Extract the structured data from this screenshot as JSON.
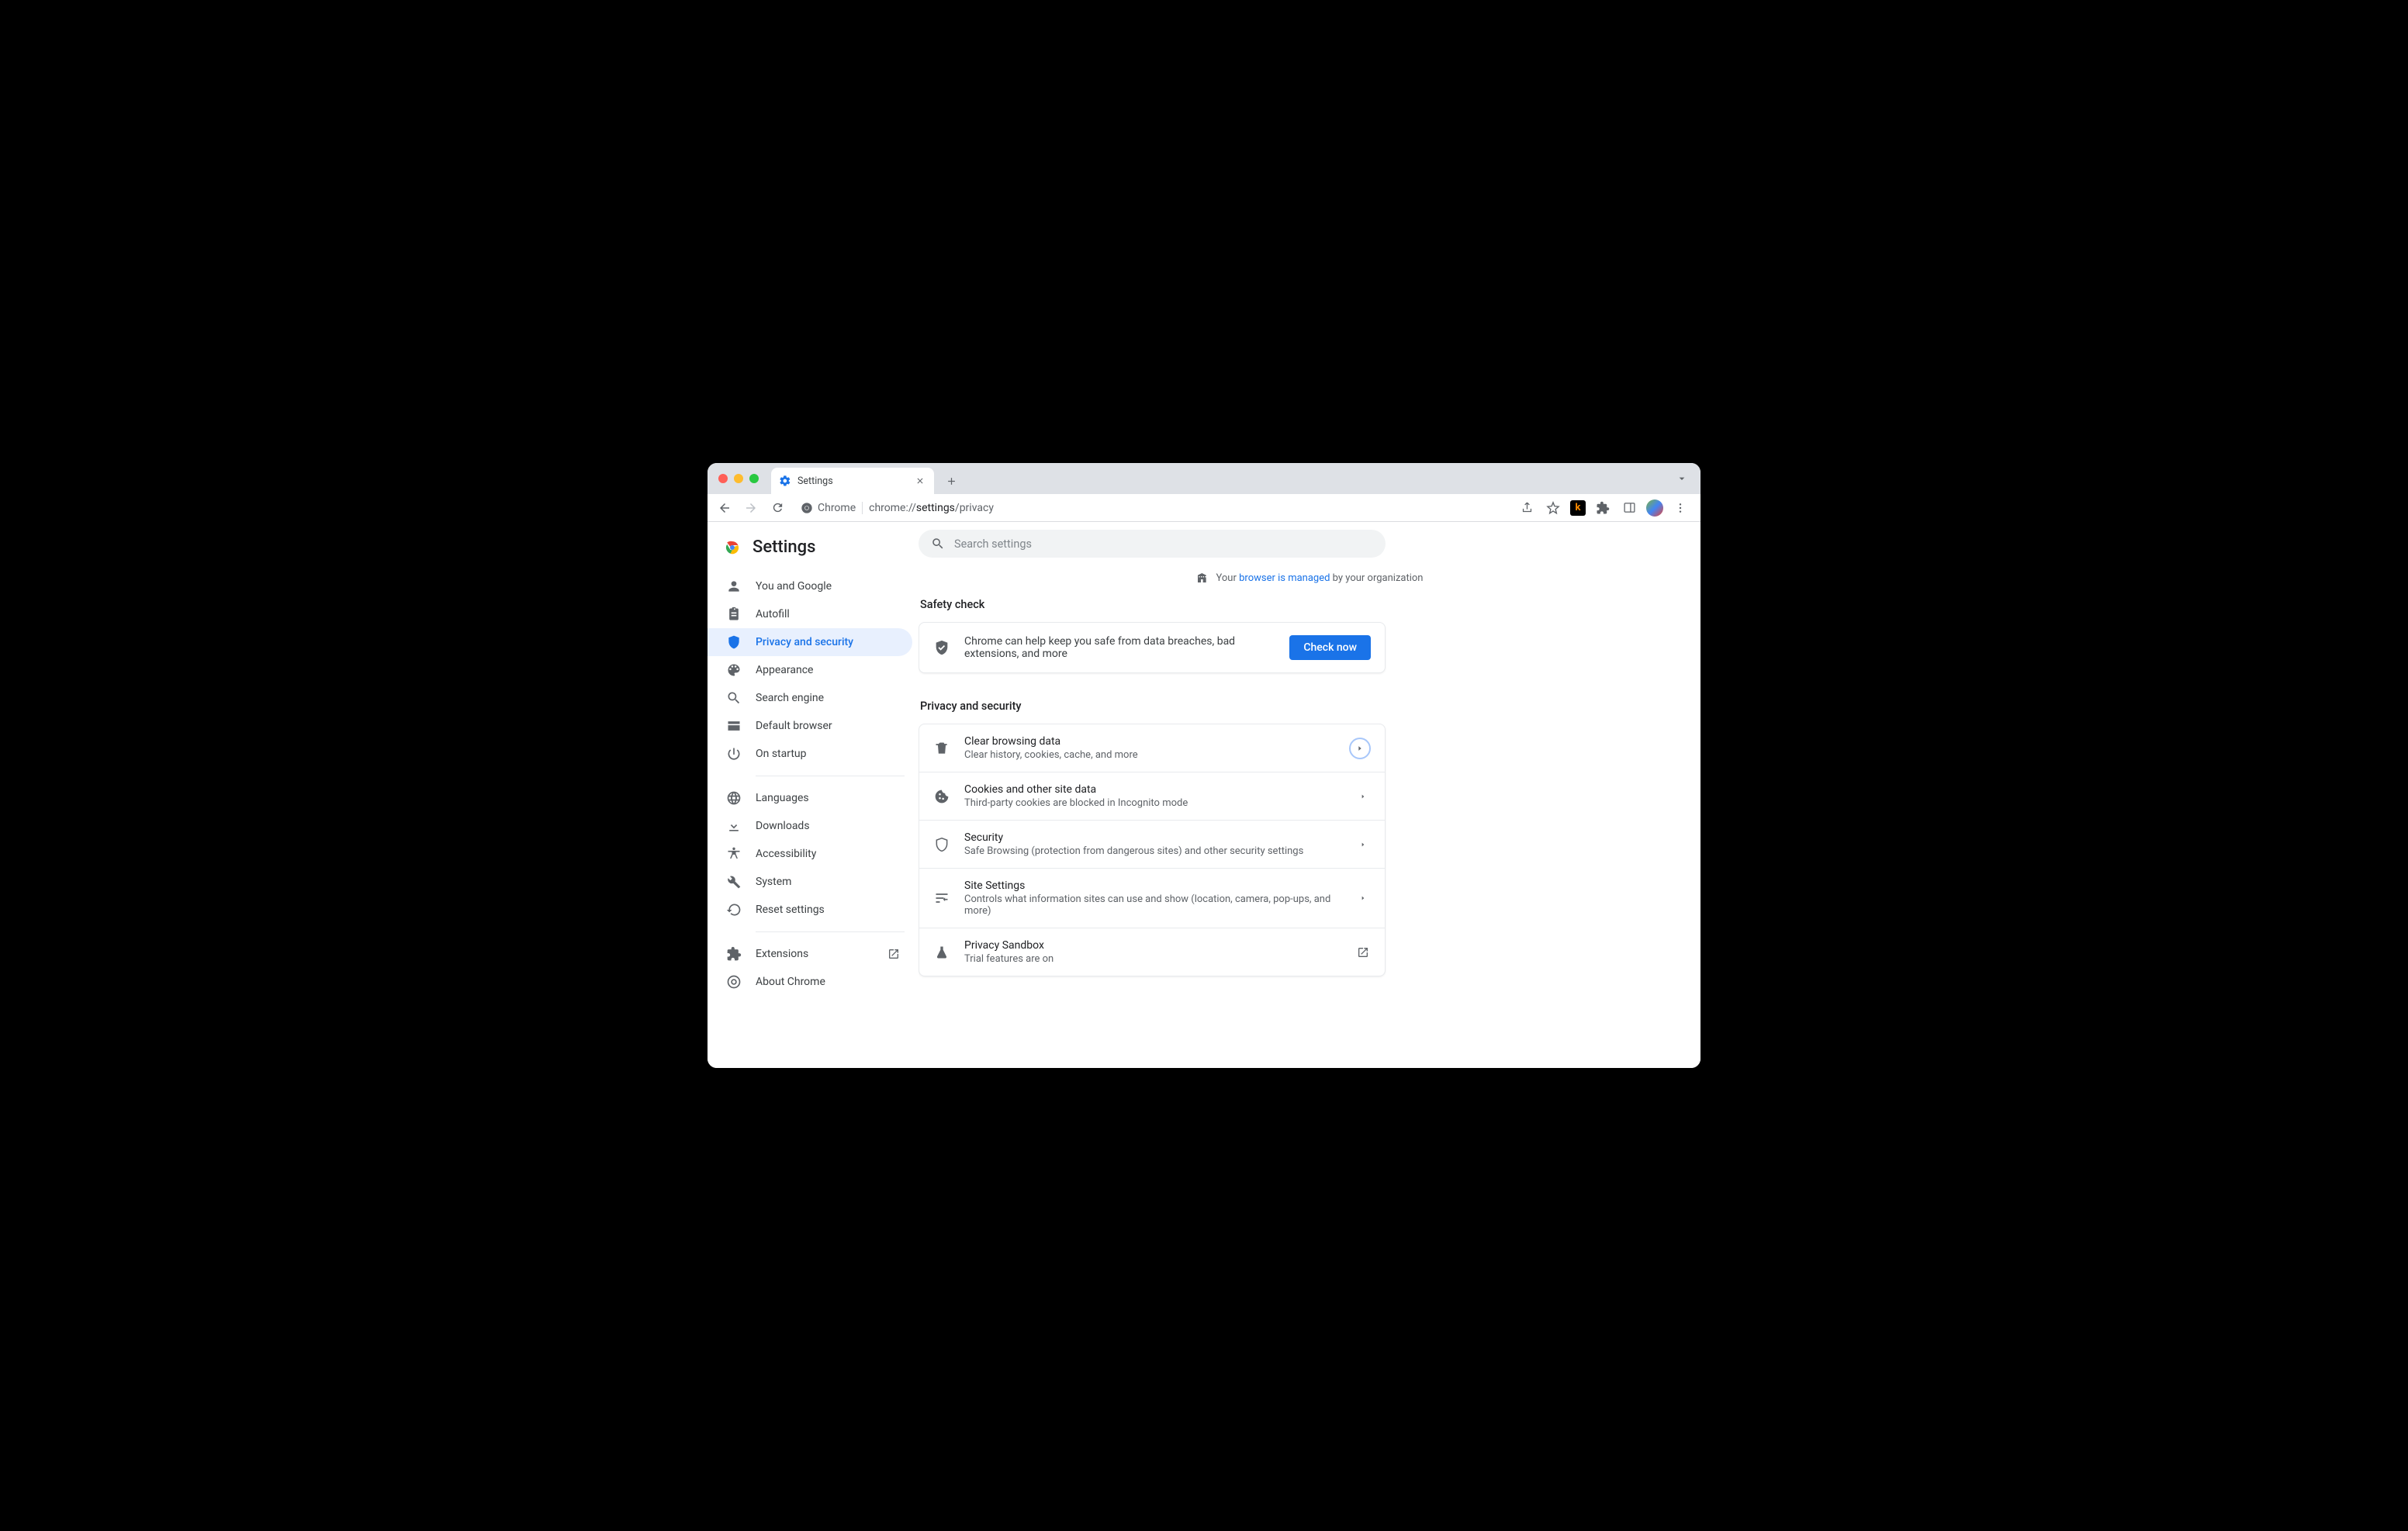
{
  "window": {
    "tab_title": "Settings"
  },
  "omnibox": {
    "origin_label": "Chrome",
    "path_prefix": "chrome://",
    "path_mid": "settings",
    "path_suffix": "/privacy"
  },
  "brand": {
    "title": "Settings"
  },
  "search": {
    "placeholder": "Search settings"
  },
  "managed": {
    "prefix": "Your ",
    "link": "browser is managed",
    "suffix": " by your organization"
  },
  "sidebar": {
    "primary": [
      {
        "label": "You and Google"
      },
      {
        "label": "Autofill"
      },
      {
        "label": "Privacy and security"
      },
      {
        "label": "Appearance"
      },
      {
        "label": "Search engine"
      },
      {
        "label": "Default browser"
      },
      {
        "label": "On startup"
      }
    ],
    "secondary": [
      {
        "label": "Languages"
      },
      {
        "label": "Downloads"
      },
      {
        "label": "Accessibility"
      },
      {
        "label": "System"
      },
      {
        "label": "Reset settings"
      }
    ],
    "footer": [
      {
        "label": "Extensions"
      },
      {
        "label": "About Chrome"
      }
    ]
  },
  "sections": {
    "safety": {
      "title": "Safety check",
      "text": "Chrome can help keep you safe from data breaches, bad extensions, and more",
      "button": "Check now"
    },
    "privacy": {
      "title": "Privacy and security",
      "rows": [
        {
          "title": "Clear browsing data",
          "sub": "Clear history, cookies, cache, and more"
        },
        {
          "title": "Cookies and other site data",
          "sub": "Third-party cookies are blocked in Incognito mode"
        },
        {
          "title": "Security",
          "sub": "Safe Browsing (protection from dangerous sites) and other security settings"
        },
        {
          "title": "Site Settings",
          "sub": "Controls what information sites can use and show (location, camera, pop-ups, and more)"
        },
        {
          "title": "Privacy Sandbox",
          "sub": "Trial features are on"
        }
      ]
    }
  }
}
